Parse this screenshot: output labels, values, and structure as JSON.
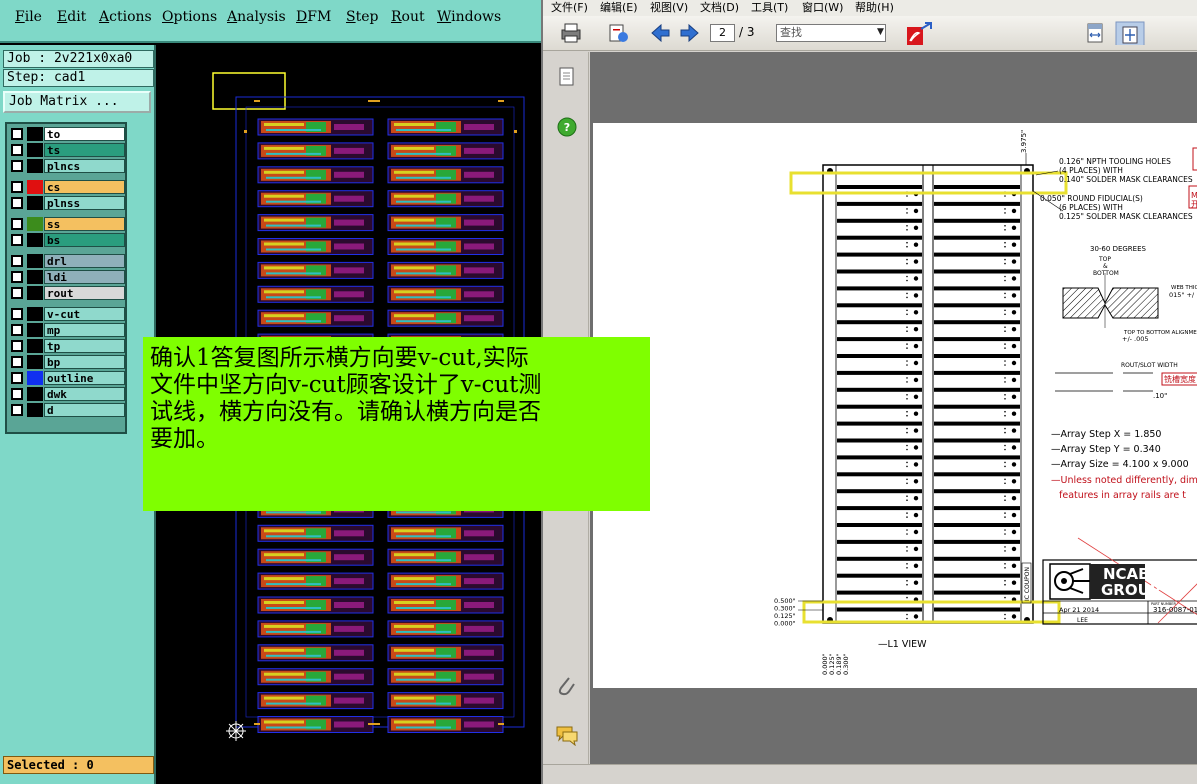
{
  "cam": {
    "menu": [
      {
        "u": "F",
        "rest": "ile"
      },
      {
        "u": "E",
        "rest": "dit"
      },
      {
        "u": "A",
        "rest": "ctions"
      },
      {
        "u": "O",
        "rest": "ptions"
      },
      {
        "u": "A",
        "rest": "nalysis"
      },
      {
        "u": "D",
        "rest": "FM"
      },
      {
        "u": "S",
        "rest": "tep"
      },
      {
        "u": "R",
        "rest": "out"
      },
      {
        "u": "W",
        "rest": "indows"
      }
    ],
    "job": "Job : 2v221x0xa0",
    "step": "Step: cad1",
    "job_matrix": "Job Matrix ...",
    "selected": "Selected : 0",
    "layers": [
      {
        "name": "to",
        "swatch": "#000000",
        "color": "#ffffff"
      },
      {
        "name": "ts",
        "swatch": "#000000",
        "color": "#2a9d7e"
      },
      {
        "name": "plncs",
        "swatch": "#000000",
        "color": "#8fd9cc"
      },
      {
        "name": "cs",
        "swatch": "#e01010",
        "color": "#f4c060",
        "checked": true
      },
      {
        "name": "plnss",
        "swatch": "#000000",
        "color": "#8fd9cc"
      },
      {
        "name": "ss",
        "swatch": "#3c8c1c",
        "color": "#f4c060"
      },
      {
        "name": "bs",
        "swatch": "#000000",
        "color": "#2a9d7e"
      },
      {
        "name": "drl",
        "swatch": "#000000",
        "color": "#8fb0ba"
      },
      {
        "name": "ldi",
        "swatch": "#000000",
        "color": "#8fb0ba"
      },
      {
        "name": "rout",
        "swatch": "#000000",
        "color": "#d8d8d8"
      },
      {
        "name": "v-cut",
        "swatch": "#000000",
        "color": "#8fd9cc"
      },
      {
        "name": "mp",
        "swatch": "#000000",
        "color": "#8fd9cc"
      },
      {
        "name": "tp",
        "swatch": "#000000",
        "color": "#8fd9cc"
      },
      {
        "name": "bp",
        "swatch": "#000000",
        "color": "#8fd9cc"
      },
      {
        "name": "outline",
        "swatch": "#1030f0",
        "color": "#8fd9cc"
      },
      {
        "name": "dwk",
        "swatch": "#000000",
        "color": "#8fd9cc"
      },
      {
        "name": "d",
        "swatch": "#000000",
        "color": "#8fd9cc"
      }
    ]
  },
  "note": {
    "lines": [
      "确认1答复图所示横方向要v-cut,实际",
      "文件中坚方向v-cut顾客设计了v-cut测",
      "试线，横方向没有。请确认横方向是否",
      "要加。"
    ]
  },
  "pdf": {
    "menu": [
      "文件(F)",
      "编辑(E)",
      "视图(V)",
      "文档(D)",
      "工具(T)",
      "窗口(W)",
      "帮助(H)"
    ],
    "page_current": "2",
    "page_total": "/ 3",
    "find_placeholder": "查找",
    "drawing": {
      "dim_top": "3.975\"",
      "note1a": "0.126\" NPTH TOOLING HOLES",
      "note1b": "(4 PLACES) WITH",
      "note1c": "0.140\" SOLDER MASK CLEARANCES",
      "note2a": "0.050\" ROUND FIDUCIAL(S)",
      "note2b": "(6 PLACES) WITH",
      "note2c": "0.125\" SOLDER MASK CLEARANCES",
      "red_tag1": "MAR",
      "red_tag2": "开窗1",
      "vcut_angle": "30-60 DEGREES",
      "vcut_top": "TOP",
      "vcut_amp": "&",
      "vcut_bottom": "BOTTOM",
      "web_thick": "WEB THICK",
      "web_tol": "015\" +/",
      "align": "TOP TO BOTTOM ALIGNMENT",
      "align_tol": "+/- .005",
      "rout_width": "ROUT/SLOT WIDTH",
      "rout_note": "铣槽宽度",
      "rout_dim": ".10\"",
      "array_x": "Array Step X = 1.850",
      "array_y": "Array Step Y = 0.340",
      "array_size": "Array Size = 4.100 x 9.000",
      "unless1": "Unless noted differently, dim",
      "unless2": "features in array rails are t",
      "coupon": "IC COUPON",
      "dim_left": [
        "0.500\"",
        "0.300\"",
        "0.125\"",
        "0.000\""
      ],
      "dim_bottom": [
        "0.000\"",
        "0.125\"",
        "0.189\"",
        "0.300\""
      ],
      "view": "L1 VIEW",
      "logo1": "NCAB",
      "logo2": "GROUP",
      "date": "Apr 21 2014",
      "part_label": "PART NUMBER",
      "part": "316-0087-01",
      "drawn": "LEE"
    }
  }
}
